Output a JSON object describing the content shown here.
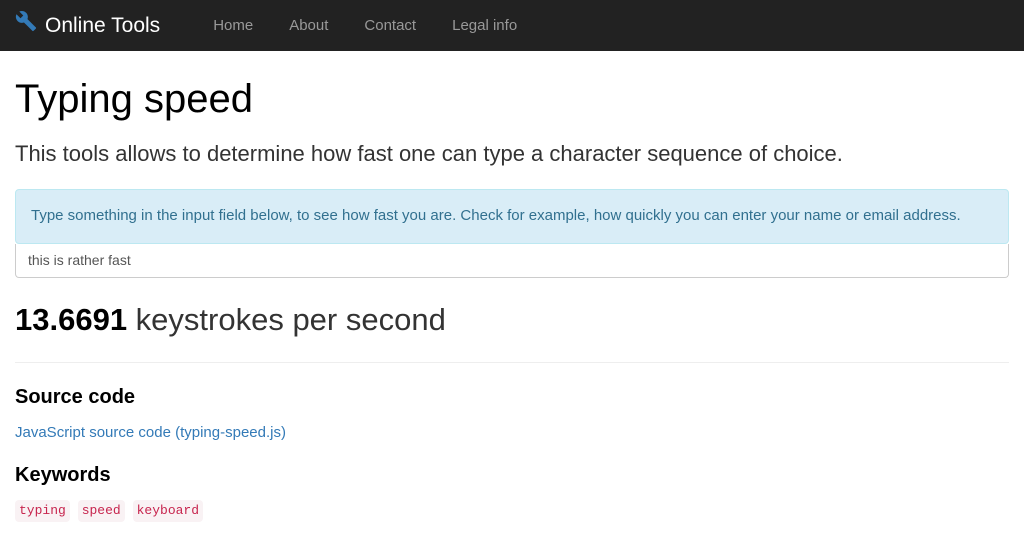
{
  "nav": {
    "brand": "Online Tools",
    "items": [
      {
        "label": "Home"
      },
      {
        "label": "About"
      },
      {
        "label": "Contact"
      },
      {
        "label": "Legal info"
      }
    ]
  },
  "page": {
    "title": "Typing speed",
    "lead": "This tools allows to determine how fast one can type a character sequence of choice.",
    "info": "Type something in the input field below, to see how fast you are. Check for example, how quickly you can enter your name or email address.",
    "input_value": "this is rather fast",
    "result_value": "13.6691",
    "result_unit": " keystrokes per second",
    "source_heading": "Source code",
    "source_link": "JavaScript source code (typing-speed.js)",
    "keywords_heading": "Keywords",
    "keywords": [
      "typing",
      "speed",
      "keyboard"
    ]
  }
}
